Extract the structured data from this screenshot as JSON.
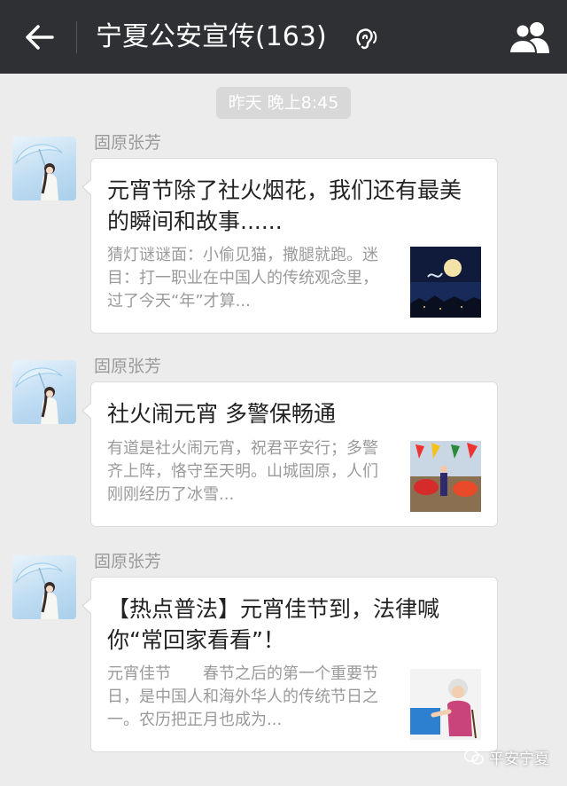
{
  "header": {
    "title": "宁夏公安宣传(163)",
    "back_icon": "arrow-left-icon",
    "earpiece_icon": "ear-icon",
    "members_icon": "group-members-icon",
    "background": "#2e3034"
  },
  "timestamp": "昨天 晚上8:45",
  "messages": [
    {
      "sender": "固原张芳",
      "title": "元宵节除了社火烟花，我们还有最美的瞬间和故事......",
      "description": "猜灯谜谜面：小偷见猫，撒腿就跑。迷目：打一职业在中国人的传统观念里，过了今天“年”才算..."
    },
    {
      "sender": "固原张芳",
      "title": "社火闹元宵 多警保畅通",
      "description": "有道是社火闹元宵，祝君平安行；多警齐上阵，恪守至天明。山城固原，人们刚刚经历了冰雪..."
    },
    {
      "sender": "固原张芳",
      "title": "【热点普法】元宵佳节到，法律喊你“常回家看看”！",
      "description": "元宵佳节　　春节之后的第一个重要节日，是中国人和海外华人的传统节日之一。农历把正月也成为..."
    }
  ],
  "watermark": "平安宁夏"
}
